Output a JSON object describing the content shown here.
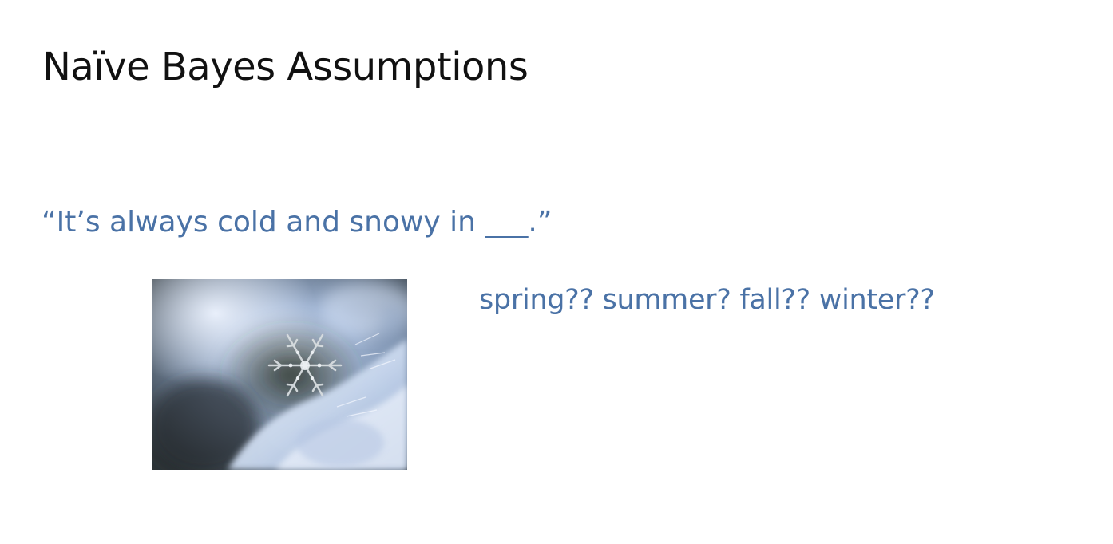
{
  "slide": {
    "title": "Naïve Bayes Assumptions",
    "quote": "“It’s always cold and snowy in ___.”",
    "options": "spring?? summer? fall?? winter??"
  },
  "photo": {
    "icon": "snowflake-photo"
  },
  "colors": {
    "title": "#111111",
    "accent": "#4a72a6",
    "background": "#ffffff"
  }
}
